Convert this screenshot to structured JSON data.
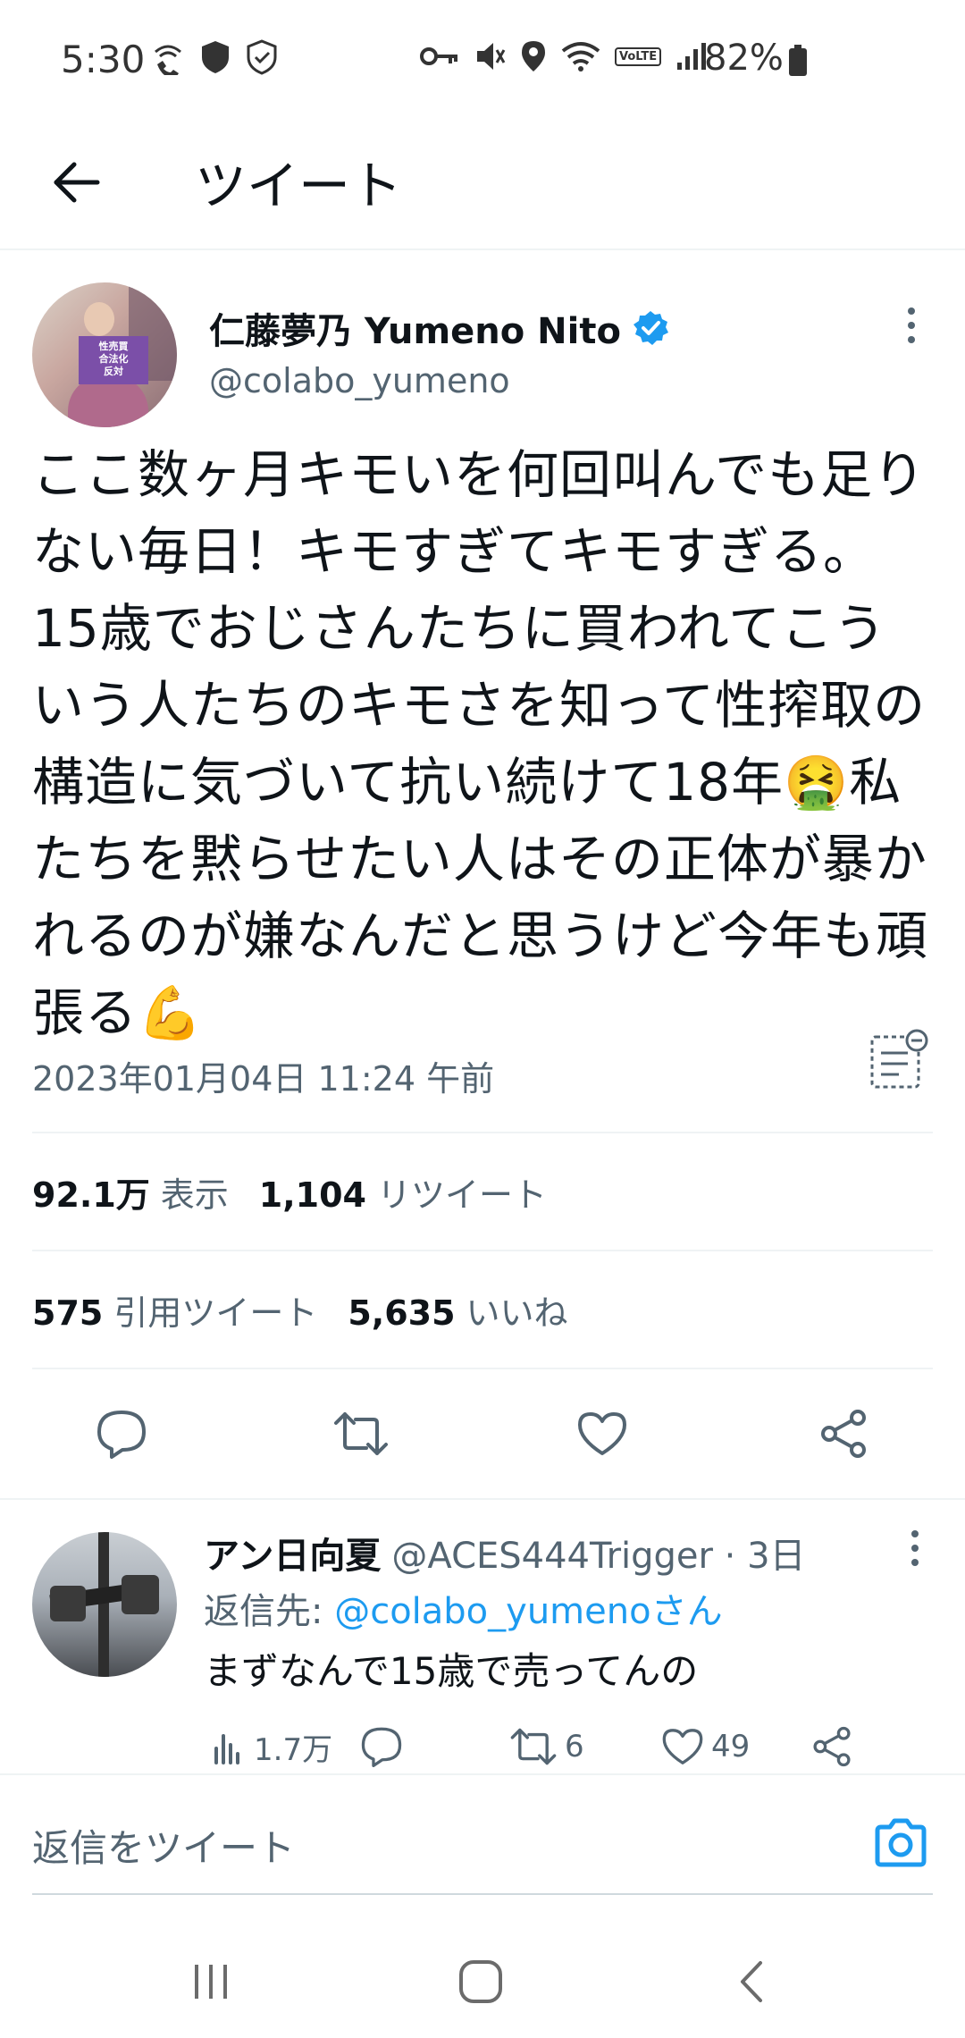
{
  "status_bar": {
    "time": "5:30",
    "battery_percent": "82%",
    "icons_left": [
      "wifi-calling-icon",
      "shield-icon",
      "shield-check-icon"
    ],
    "icons_right": [
      "key-icon",
      "mute-icon",
      "location-icon",
      "wifi-icon",
      "volte-icon",
      "signal-icon",
      "battery-icon"
    ],
    "volte_label": "VoLTE"
  },
  "header": {
    "title": "ツイート"
  },
  "tweet": {
    "display_name": "仁藤夢乃 Yumeno Nito",
    "handle": "@colabo_yumeno",
    "avatar_sign_text": "性売買\n合法化\n反対",
    "text": "ここ数ヶ月キモいを何回叫んでも足りない毎日！キモすぎてキモすぎる。15歳でおじさんたちに買われてこういう人たちのキモさを知って性搾取の構造に気づいて抗い続けて18年🤮私たちを黙らせたい人はその正体が暴かれるのが嫌なんだと思うけど今年も頑張る💪",
    "timestamp": "2023年01月04日 11:24 午前",
    "stats": {
      "views_value": "92.1万",
      "views_label": "表示",
      "retweets_value": "1,104",
      "retweets_label": "リツイート",
      "quotes_value": "575",
      "quotes_label": "引用ツイート",
      "likes_value": "5,635",
      "likes_label": "いいね"
    }
  },
  "reply": {
    "display_name": "アン日向夏",
    "handle_meta": "@ACES444Trigger · 3日",
    "reply_to_prefix": "返信先: ",
    "reply_to_link": "@colabo_yumenoさん",
    "text": "まずなんで15歳で売ってんの",
    "views": "1.7万",
    "retweets": "6",
    "likes": "49"
  },
  "compose": {
    "placeholder": "返信をツイート"
  },
  "colors": {
    "accent": "#1d9bf0",
    "text_primary": "#0f1419",
    "text_secondary": "#536471",
    "divider": "#eff3f4"
  }
}
